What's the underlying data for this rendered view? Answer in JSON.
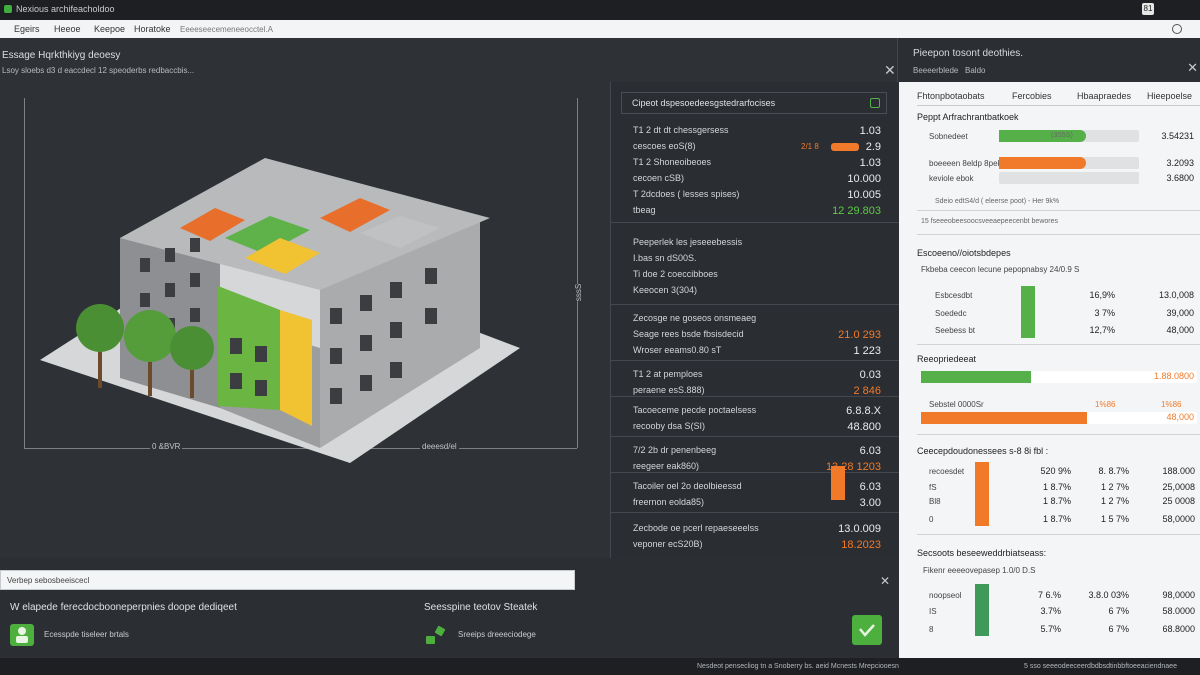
{
  "titlebar": {
    "title": "Nexious archifeacholdoo",
    "btn": "81"
  },
  "menu": [
    "Egeirs",
    "Heeoe",
    "Keepoe",
    "Horatoke"
  ],
  "menu_extra": "Eeeeseecemeneeocctel.A",
  "viewport": {
    "title": "Essage Hqrkthkiyg deoesy",
    "subtitle": "Lsoy sloebs  d3  d  eaccdecl  12  speoderbs  redbaccbis...",
    "label_left": "0 &BVR",
    "label_right": "deeesd/el",
    "label_vertical": "sssS"
  },
  "stats": {
    "header": "Cipeot dspesoedeesgstedrarfocises",
    "rows": [
      {
        "l": "T1 2 dt  dt  chessgersess",
        "r": "1.03",
        "c": ""
      },
      {
        "l": "cescoes eoS(8)",
        "r": "2.9",
        "c": "",
        "tag": "2/1 8"
      },
      {
        "l": "T1 2  Shoneoibeoes",
        "r": "1.03",
        "c": ""
      },
      {
        "l": "cecoen cSB)",
        "r": "10.000",
        "c": ""
      },
      {
        "l": "T  2dcdoes  ( lesses spises)",
        "r": "10.005",
        "c": ""
      },
      {
        "l": "tbeag",
        "r": "12 29.803",
        "c": "green"
      },
      {
        "l": "Peeperlek les  jeseeebessis",
        "r": "",
        "c": ""
      },
      {
        "l": "I.bas sn dS00S.",
        "r": "",
        "c": ""
      },
      {
        "l": "Ti doe  2  coeccibboes",
        "r": "",
        "c": ""
      },
      {
        "l": "Keeocen 3(304)",
        "r": "",
        "c": ""
      },
      {
        "l": "Zecosge ne goseos  onsmeaeg",
        "r": "",
        "c": ""
      },
      {
        "l": "Seage rees  bsde  fbsisdecid",
        "r": "21.0 293",
        "c": "orange"
      },
      {
        "l": "Wroser eeams0.80 sT",
        "r": "1 223",
        "c": ""
      },
      {
        "l": "T1 2  at  pemploes",
        "r": "0.03",
        "c": ""
      },
      {
        "l": "peraene esS.888)",
        "r": "2 846",
        "c": "orange"
      },
      {
        "l": "Tacoeceme pecde poctaelsess",
        "r": "6.8.8.X",
        "c": ""
      },
      {
        "l": "recooby dsa S(SI)",
        "r": "48.800",
        "c": ""
      },
      {
        "l": "7/2 2b  dr  penenbeeg",
        "r": "6.03",
        "c": ""
      },
      {
        "l": "reegeer eak860)",
        "r": "13 28 1203",
        "c": "orange"
      },
      {
        "l": "Tacoiler oel 2o  deolbieessd",
        "r": "6.03",
        "c": ""
      },
      {
        "l": "freernon eolda85)",
        "r": "3.00",
        "c": ""
      },
      {
        "l": "Zecbode oe  pcerl repaeseeelss",
        "r": "13.0.009",
        "c": ""
      },
      {
        "l": "veponer ecS20B)",
        "r": "18.2023",
        "c": "orange"
      }
    ]
  },
  "rpanel": {
    "title": "Pieepon tosont deothies.",
    "sub1": "Beeeerblede",
    "sub2": "Baldo",
    "tabs": [
      "Fhtonpbotaobats",
      "Fercobies",
      "Hbaapraedes",
      "Hieepoelse"
    ],
    "sec1": "Peppt Arfrachrantbatkoek",
    "bars1": [
      {
        "label": "Sobnedeet",
        "value": "3.54231",
        "pct": 0.62,
        "color": "#56b04a",
        "inner": "(3S5S)"
      },
      {
        "label": "boeeeen  8eldp 8pekk",
        "value": "3.2093",
        "pct": 0.62,
        "color": "#f07a2a",
        "inner": ""
      },
      {
        "label": "keviole  ebok",
        "value": "3.6800",
        "pct": 0.0,
        "color": "#56b04a",
        "inner": ""
      }
    ],
    "note1": "Sdeio   edtS4/d ( eleerse poot)  -   Her 9k%",
    "note2": "15 fseeeobeesoocsveeaepeecenbt bewores",
    "sec2": "Escoeeno//oiotsbdepes",
    "sec2_sub": "Fkbeba  ceecon lecune  pepopnabsy  24/0.9 S",
    "rows2": [
      {
        "l": "Esbcesdbt",
        "a": "16,9%",
        "b": "13.0,008"
      },
      {
        "l": "Soededc",
        "a": "3 7%",
        "b": "39,000"
      },
      {
        "l": "Seebess bt",
        "a": "12,7%",
        "b": "48,000"
      }
    ],
    "sec3": "Reeopriedeeat",
    "bar3_value": "1.88.0800",
    "bar3_pct": 0.4,
    "bar4_label": "Sebstel 0000Sr",
    "bar4_tag": "1%86",
    "bar4_value": "48,000",
    "bar4_pct": 0.6,
    "sec4": "Ceecepdoudonessees s-8 8i fbl :",
    "rows4": [
      {
        "l": "recoesdet",
        "a": "520 9%",
        "m": "8.  8.7%",
        "b": "188.000"
      },
      {
        "l": "fS",
        "a": "1 8.7%",
        "m": "1 2 7%",
        "b": "25,0008"
      },
      {
        "l": "Bl8",
        "a": "1 8.7%",
        "m": "1 2 7%",
        "b": "25 0008"
      },
      {
        "l": "0",
        "a": "1 8.7%",
        "m": "1 5 7%",
        "b": "58,0000"
      }
    ],
    "sec5": "Secsoots beseeweddrbiatseass:",
    "sec5_sub": "Fikenr  eeeeovepasep 1.0/0 D.S",
    "rows5": [
      {
        "l": "noopseol",
        "a": "7 6.%",
        "m": "3.8.0 03%",
        "b": "98,0000"
      },
      {
        "l": "IS",
        "a": "3.7%",
        "m": "6 7%",
        "b": "58.0000"
      },
      {
        "l": "8",
        "a": "5.7%",
        "m": "6 7%",
        "b": "68.8000"
      }
    ]
  },
  "bottom": {
    "search": "Verbep sebosbeeiscecl",
    "title1": "W elapede ferecdocbooneperpnies doope dediqeet",
    "label1": "Ecesspde tiseleer brtals",
    "title2": "Seesspine teotov Steatek",
    "label2": "Sreeips dreeeciodege"
  },
  "status": {
    "left": "Nesdeot  pensecliog tn a Snoberry bs. aeid Mcnests Mrepciooesn",
    "right": "5  sso  seeeodeeceerdbdbsdtinbbftoeeaciendnaee"
  },
  "colors": {
    "accent_green": "#56b04a",
    "accent_orange": "#f07a2a"
  }
}
